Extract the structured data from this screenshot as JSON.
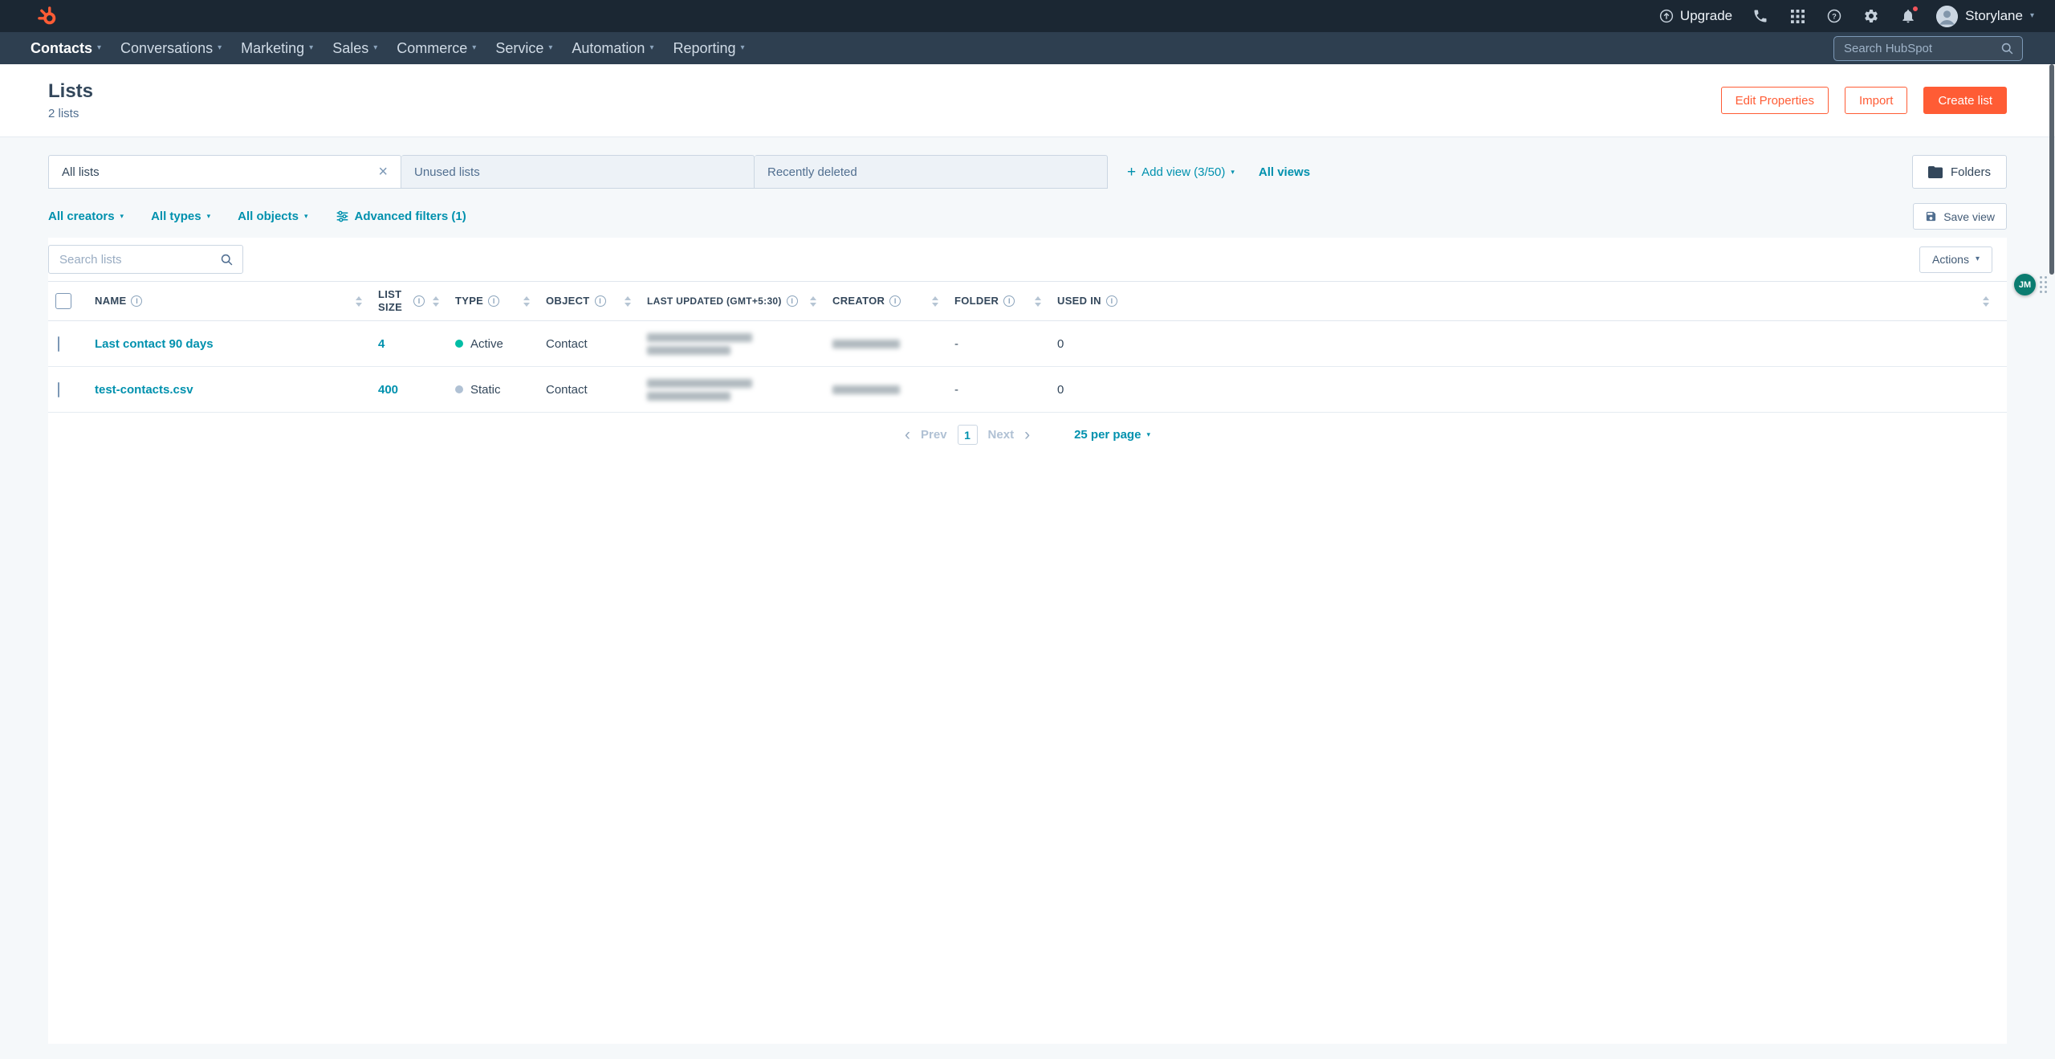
{
  "colors": {
    "brand_orange": "#ff5c35",
    "link_blue": "#0091ae",
    "nav_dark": "#1b2733",
    "nav_menu": "#2e3f50",
    "active_dot": "#00bda5",
    "static_dot": "#b0c1d4"
  },
  "topbar": {
    "upgrade_label": "Upgrade",
    "account_name": "Storylane",
    "search_placeholder": "Search HubSpot",
    "icons": [
      "upgrade-icon",
      "phone-icon",
      "marketplace-icon",
      "help-icon",
      "settings-icon",
      "notifications-icon"
    ]
  },
  "nav": {
    "items": [
      {
        "label": "Contacts",
        "active": true
      },
      {
        "label": "Conversations"
      },
      {
        "label": "Marketing"
      },
      {
        "label": "Sales"
      },
      {
        "label": "Commerce"
      },
      {
        "label": "Service"
      },
      {
        "label": "Automation"
      },
      {
        "label": "Reporting"
      }
    ]
  },
  "page_header": {
    "title": "Lists",
    "subtitle": "2 lists",
    "edit_properties_label": "Edit Properties",
    "import_label": "Import",
    "create_list_label": "Create list"
  },
  "views_toolbar": {
    "tabs": [
      {
        "label": "All lists",
        "active": true,
        "closable": true
      },
      {
        "label": "Unused lists"
      },
      {
        "label": "Recently deleted"
      }
    ],
    "add_view_label": "Add view (3/50)",
    "all_views_label": "All views",
    "folders_label": "Folders"
  },
  "filters_toolbar": {
    "creators_label": "All creators",
    "types_label": "All types",
    "objects_label": "All objects",
    "advanced_label": "Advanced filters (1)",
    "save_view_label": "Save view"
  },
  "lists_table": {
    "search_placeholder": "Search lists",
    "actions_label": "Actions",
    "columns": [
      "NAME",
      "LIST SIZE",
      "TYPE",
      "OBJECT",
      "LAST UPDATED (GMT+5:30)",
      "CREATOR",
      "FOLDER",
      "USED IN"
    ],
    "rows": [
      {
        "name": "Last contact 90 days",
        "list_size": "4",
        "type": "Active",
        "type_dot_color": "#00bda5",
        "object": "Contact",
        "last_updated_blurred": true,
        "creator_blurred": true,
        "folder": "-",
        "used_in": "0"
      },
      {
        "name": "test-contacts.csv",
        "list_size": "400",
        "type": "Static",
        "type_dot_color": "#b0c1d4",
        "object": "Contact",
        "last_updated_blurred": true,
        "creator_blurred": true,
        "folder": "-",
        "used_in": "0"
      }
    ]
  },
  "pagination": {
    "prev_label": "Prev",
    "current_page": "1",
    "next_label": "Next",
    "per_page_label": "25 per page"
  },
  "floating_widget": {
    "badge": "JM"
  }
}
